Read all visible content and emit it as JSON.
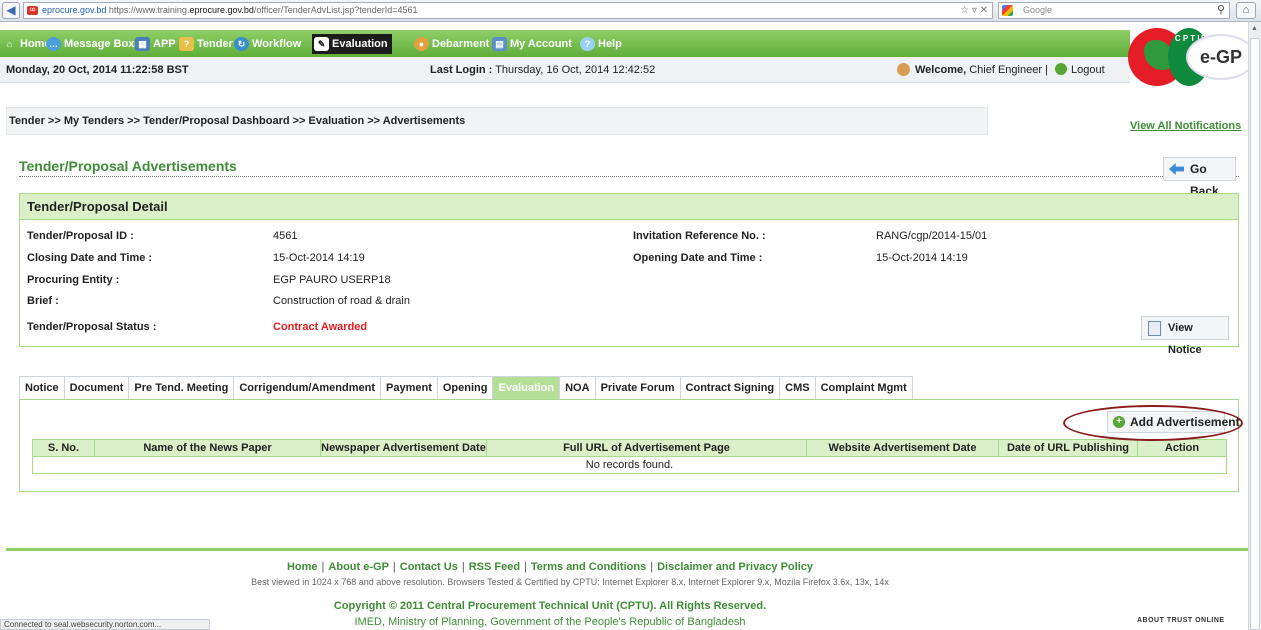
{
  "browser": {
    "url_site": "eprocure.gov.bd",
    "url_prefix": "https://www.training.",
    "url_domain": "eprocure.gov.bd",
    "url_path": "/officer/TenderAdvList.jsp?tenderId=4561",
    "search_placeholder": "Google",
    "status_text": "Connected to seal.websecurity.norton.com..."
  },
  "nav": {
    "items": [
      {
        "label": "Home",
        "icon": "home-icon"
      },
      {
        "label": "Message Box",
        "icon": "message-icon"
      },
      {
        "label": "APP",
        "icon": "calendar-icon"
      },
      {
        "label": "Tender",
        "icon": "tender-icon"
      },
      {
        "label": "Workflow",
        "icon": "workflow-icon"
      },
      {
        "label": "Evaluation",
        "icon": "edit-icon"
      },
      {
        "label": "Debarment",
        "icon": "debarment-icon"
      },
      {
        "label": "My Account",
        "icon": "account-icon"
      },
      {
        "label": "Help",
        "icon": "help-icon"
      }
    ]
  },
  "info": {
    "datetime": "Monday, 20 Oct, 2014 11:22:58 BST",
    "last_login_label": "Last Login :",
    "last_login_value": "Thursday, 16 Oct, 2014 12:42:52",
    "welcome_label": "Welcome,",
    "welcome_user": "Chief Engineer",
    "separator": "|",
    "logout": "Logout"
  },
  "logo": {
    "cptu_letters": "C P T U",
    "egp": "e-GP"
  },
  "breadcrumb": "Tender >> My Tenders >> Tender/Proposal Dashboard >> Evaluation >> Advertisements",
  "view_all_notifications": "View All Notifications",
  "page_title": "Tender/Proposal Advertisements",
  "go_back": "Go Back",
  "detail": {
    "heading": "Tender/Proposal Detail",
    "id_label": "Tender/Proposal ID :",
    "id_value": "4561",
    "closing_label": "Closing Date and Time :",
    "closing_value": "15-Oct-2014 14:19",
    "entity_label": "Procuring Entity :",
    "entity_value": "EGP PAURO USERP18",
    "brief_label": "Brief :",
    "brief_value": "Construction of road & drain",
    "status_label": "Tender/Proposal Status :",
    "status_value": "Contract Awarded",
    "invitation_label": "Invitation Reference No. :",
    "invitation_value": "RANG/cgp/2014-15/01",
    "opening_label": "Opening Date and Time :",
    "opening_value": "15-Oct-2014 14:19",
    "view_notice": "View Notice"
  },
  "tabs": [
    "Notice",
    "Document",
    "Pre Tend. Meeting",
    "Corrigendum/Amendment",
    "Payment",
    "Opening",
    "Evaluation",
    "NOA",
    "Private Forum",
    "Contract Signing",
    "CMS",
    "Complaint Mgmt"
  ],
  "active_tab": "Evaluation",
  "add_advertisement": "Add Advertisement",
  "table": {
    "columns": [
      "S. No.",
      "Name of the News Paper",
      "Newspaper Advertisement Date",
      "Full URL of Advertisement Page",
      "Website Advertisement Date",
      "Date of URL Publishing",
      "Action"
    ],
    "empty_message": "No records found."
  },
  "footer": {
    "links": [
      "Home",
      "About e-GP",
      "Contact Us",
      "RSS Feed",
      "Terms and Conditions",
      "Disclaimer and Privacy Policy"
    ],
    "best_viewed": "Best viewed in 1024 x 768 and above resolution. Browsers Tested & Certified by CPTU: Internet Explorer 8.x, Internet Explorer 9.x, Mozila Firefox 3.6x, 13x, 14x",
    "copyright": "Copyright © 2011 Central Procurement Technical Unit (CPTU). All Rights Reserved.",
    "ministry": "IMED, Ministry of Planning, Government of the People's Republic of Bangladesh",
    "trust": "ABOUT TRUST ONLINE"
  },
  "colors": {
    "accent": "#5fae3a",
    "link": "#3f8e37",
    "status_red": "#e02020",
    "highlight_ring": "#8b1a1a"
  }
}
